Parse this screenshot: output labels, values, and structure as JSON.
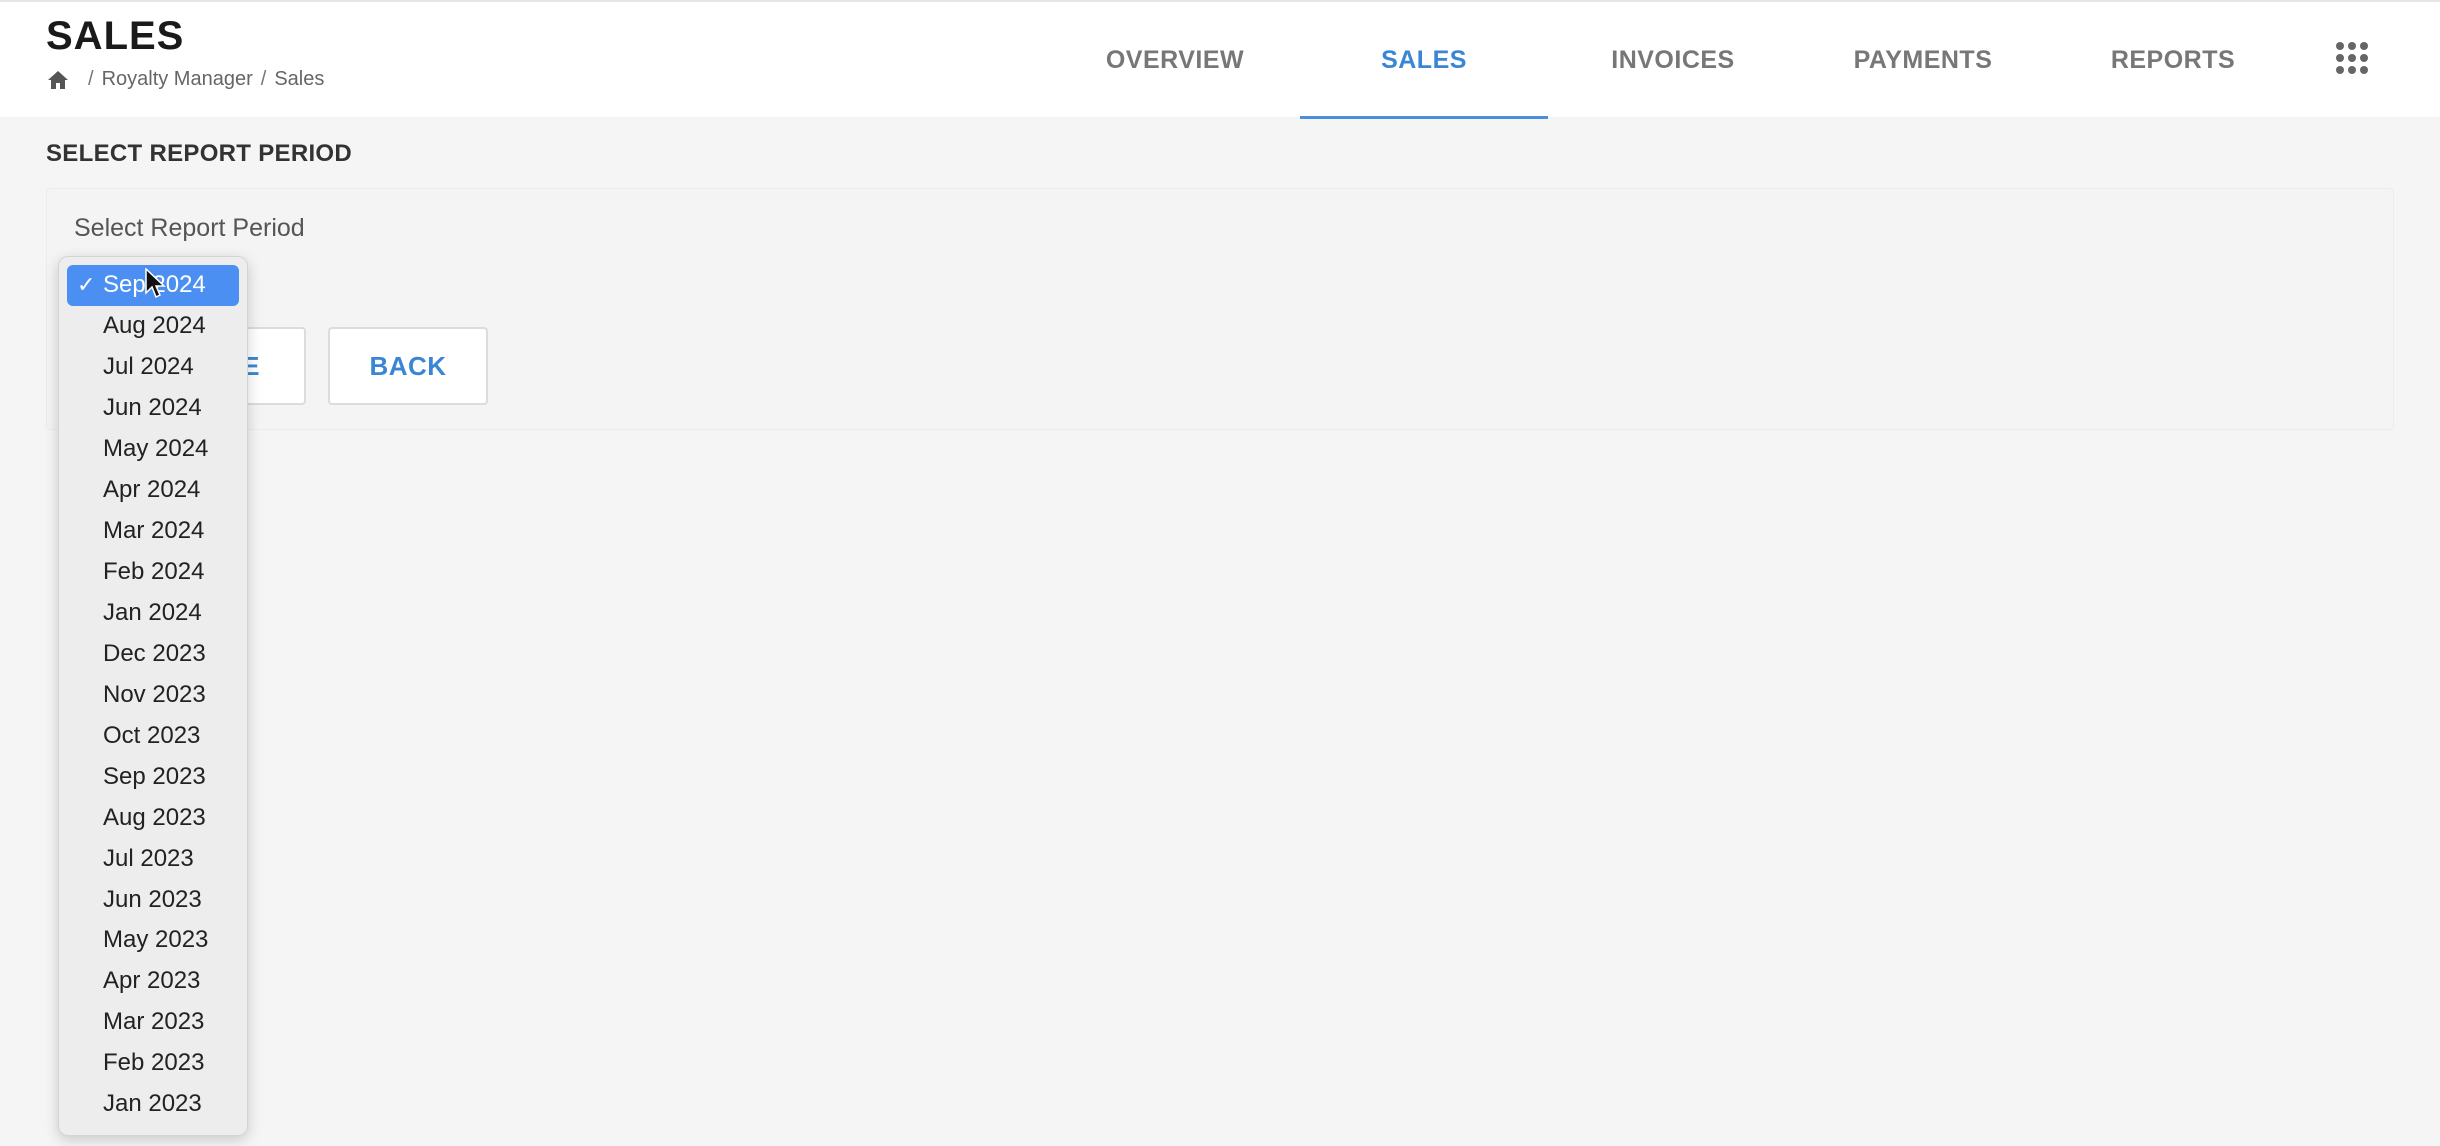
{
  "header": {
    "title": "SALES",
    "breadcrumb": [
      "Royalty Manager",
      "Sales"
    ],
    "separator": "/",
    "icons": {
      "home": "home-icon",
      "apps": "grid-icon"
    }
  },
  "nav": {
    "tabs": [
      {
        "label": "OVERVIEW",
        "active": false
      },
      {
        "label": "SALES",
        "active": true
      },
      {
        "label": "INVOICES",
        "active": false
      },
      {
        "label": "PAYMENTS",
        "active": false
      },
      {
        "label": "REPORTS",
        "active": false
      }
    ]
  },
  "main": {
    "section_title": "SELECT REPORT PERIOD",
    "field_label": "Select Report Period",
    "continue_label": "E",
    "back_label": "BACK"
  },
  "dropdown": {
    "selected": "Sep 2024",
    "options": [
      "Sep 2024",
      "Aug 2024",
      "Jul 2024",
      "Jun 2024",
      "May 2024",
      "Apr 2024",
      "Mar 2024",
      "Feb 2024",
      "Jan 2024",
      "Dec 2023",
      "Nov 2023",
      "Oct 2023",
      "Sep 2023",
      "Aug 2023",
      "Jul 2023",
      "Jun 2023",
      "May 2023",
      "Apr 2023",
      "Mar 2023",
      "Feb 2023",
      "Jan 2023"
    ]
  },
  "colors": {
    "accent": "#3a86d4",
    "selected_option": "#4c8ff3",
    "background": "#f5f5f5"
  }
}
